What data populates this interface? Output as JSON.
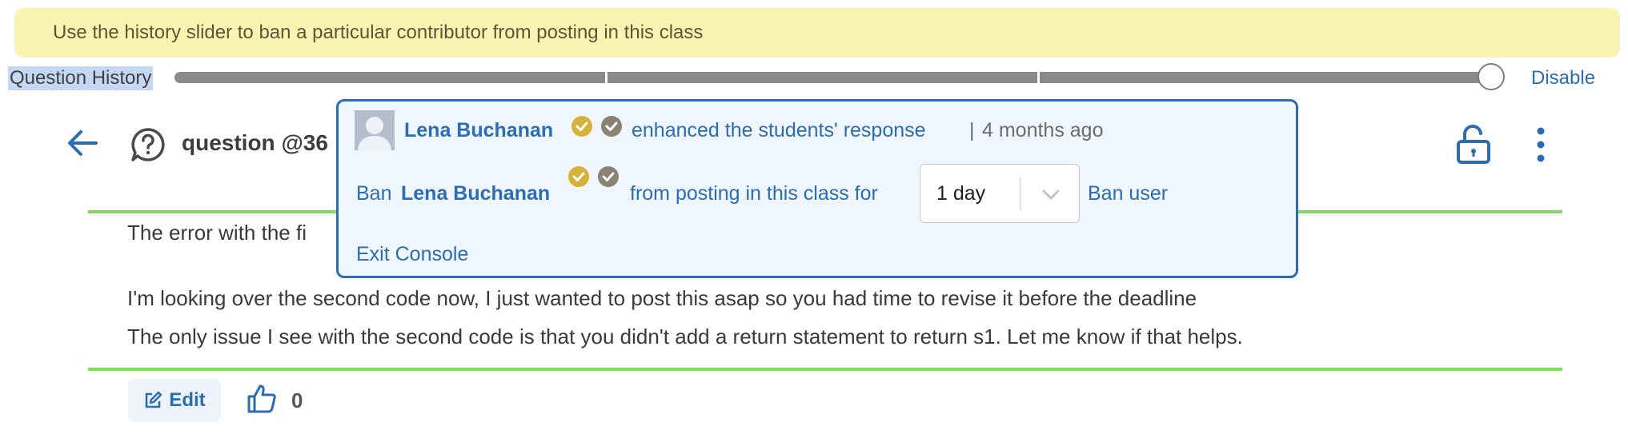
{
  "banner": {
    "text": "Use the history slider to ban a particular contributor from posting in this class"
  },
  "history": {
    "label": "Question History",
    "disable_label": "Disable",
    "slider_position": 1.0
  },
  "question": {
    "title": "question @36",
    "paragraphs": [
      "The error with the fi",
      "I'm looking over the second code now, I just wanted to post this asap so you had time to revise it before the deadline",
      "The only issue I see with the second code is that you didn't add a return statement to return s1. Let me know if that helps."
    ],
    "edit_label": "Edit",
    "like_count": "0"
  },
  "console": {
    "user_name": "Lena Buchanan",
    "action_text": "enhanced the students' response",
    "separator": "|",
    "time_ago": "4 months ago",
    "ban_prefix": "Ban",
    "ban_middle": "from posting in this class for",
    "duration": "1 day",
    "ban_button": "Ban user",
    "exit_label": "Exit Console"
  },
  "colors": {
    "link_blue": "#2a6db5",
    "banner_yellow": "#f9f4b1",
    "divider_green": "#7ddf57",
    "badge_gold": "#d7b13a",
    "badge_grey": "#8a8273"
  },
  "icons": [
    "back-arrow-icon",
    "question-bubble-icon",
    "unlock-icon",
    "more-vertical-icon",
    "endorse-badge-icon",
    "instructor-check-icon",
    "chevron-down-icon",
    "edit-icon",
    "thumbs-up-icon"
  ]
}
